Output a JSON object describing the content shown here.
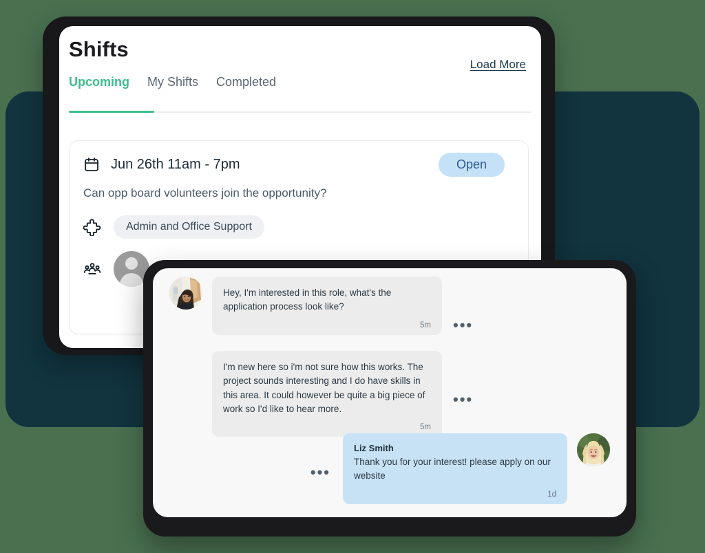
{
  "colors": {
    "page_background": "#4a7050",
    "backdrop_panel": "#11343f",
    "device_bezel": "#18181a",
    "accent_green": "#3cbd8b",
    "badge_blue_bg": "#c5e1f7",
    "badge_blue_text": "#2a5d8f",
    "chip_gray_bg": "#eef0f3",
    "bubble_gray": "#ececec",
    "bubble_blue": "#c7e2f5",
    "chat_panel_bg": "#f8f8f8"
  },
  "shifts": {
    "title": "Shifts",
    "load_more_label": "Load More",
    "tabs": [
      {
        "label": "Upcoming",
        "active": true
      },
      {
        "label": "My Shifts",
        "active": false
      },
      {
        "label": "Completed",
        "active": false
      }
    ],
    "card": {
      "calendar_icon": "calendar-icon",
      "datetime": "Jun 26th 11am - 7pm",
      "status_badge": "Open",
      "question": "Can opp board volunteers join the opportunity?",
      "category_icon": "puzzle-piece-icon",
      "category_tag": "Admin and Office Support",
      "people_icon": "group-people-icon",
      "volunteer_avatar_alt": "placeholder-avatar"
    }
  },
  "chat": {
    "menu_icon": "ellipsis-horizontal-icon",
    "messages": [
      {
        "id": "msg-1",
        "direction": "incoming",
        "sender": "",
        "text": "Hey, I'm interested in this role, what's the application process look like?",
        "time": "5m",
        "avatar": "avatar-woman-photo"
      },
      {
        "id": "msg-2",
        "direction": "incoming",
        "sender": "",
        "text": "I'm new here so i'm not sure how this works. The project sounds interesting and I do have skills in this area. It could however be quite a big piece of work so I'd like to hear more.",
        "time": "5m",
        "avatar": ""
      },
      {
        "id": "msg-3",
        "direction": "outgoing",
        "sender": "Liz Smith",
        "text": "Thank you for your interest! please apply on our website",
        "time": "1d",
        "avatar": "avatar-blonde-woman-photo"
      }
    ]
  }
}
